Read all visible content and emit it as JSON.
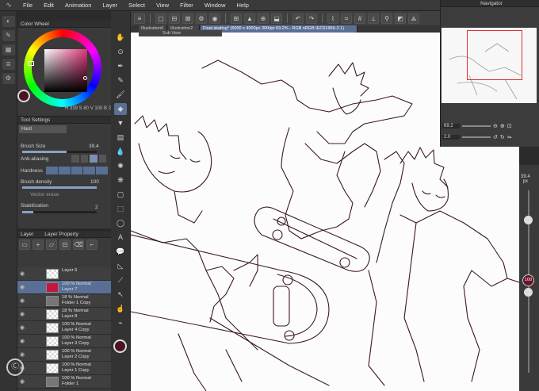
{
  "menubar": {
    "items": [
      "File",
      "Edit",
      "Animation",
      "Layer",
      "Select",
      "View",
      "Filter",
      "Window",
      "Help"
    ]
  },
  "tabs": [
    {
      "label": "Illustration6"
    },
    {
      "label": "Illustration2"
    },
    {
      "label": "Final skating* (5000 x 4000px 300dpi 69.2% - RGB sRGB IEC61966-2.1)"
    }
  ],
  "subview": {
    "title": "Sub View"
  },
  "color_panel": {
    "title": "Color Wheel",
    "hsv_readout": "H 339  S 80  V 100  B 25",
    "current_color": "#4a1420"
  },
  "tool_settings": {
    "title": "Tool Settings",
    "preset": "Hard",
    "brush_size_label": "Brush Size",
    "brush_size_value": "39.4",
    "anti_aliasing_label": "Anti-aliasing",
    "hardness_label": "Hardness",
    "brush_density_label": "Brush density",
    "brush_density_value": "100",
    "vector_erase_label": "Vector erase",
    "stabilization_label": "Stabilization",
    "stabilization_value": "2"
  },
  "layer_panel": {
    "tab_layer": "Layer",
    "tab_props": "Layer Property",
    "layers": [
      {
        "line1": "Layer 6",
        "line2": "",
        "thumb": "plain"
      },
      {
        "line1": "100 %  Normal",
        "line2": "Layer 7",
        "thumb": "red"
      },
      {
        "line1": "18 %  Normal",
        "line2": "Folder 1 Copy",
        "thumb": "folder"
      },
      {
        "line1": "18 %  Normal",
        "line2": "Layer 8",
        "thumb": "plain"
      },
      {
        "line1": "100 %  Normal",
        "line2": "Layer 4 Copy",
        "thumb": "plain"
      },
      {
        "line1": "100 %  Normal",
        "line2": "Layer 3 Copy",
        "thumb": "plain"
      },
      {
        "line1": "100 %  Normal",
        "line2": "Layer 2 Copy",
        "thumb": "plain"
      },
      {
        "line1": "100 %  Normal",
        "line2": "Layer 1 Copy",
        "thumb": "plain"
      },
      {
        "line1": "100 %  Normal",
        "line2": "Folder 1",
        "thumb": "folder"
      }
    ]
  },
  "navigator": {
    "title": "Navigator",
    "zoom": "69.2",
    "rotation": "2.0"
  },
  "brush_bar": {
    "size": "39.4",
    "unit": "px",
    "opacity": "100"
  }
}
